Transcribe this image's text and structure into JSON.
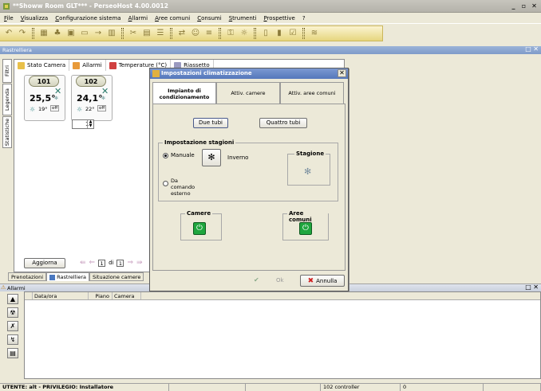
{
  "app": {
    "title": "**Showw Room GLT*** - PerseoHost 4.00.0012",
    "minimize": "_",
    "restore": "▫",
    "close": "✕"
  },
  "menu": [
    "File",
    "Visualizza",
    "Configurazione sistema",
    "Allarmi",
    "Aree comuni",
    "Consumi",
    "Strumenti",
    "Prospettive",
    "?"
  ],
  "mdi": {
    "title": "Rastrelliera",
    "close": "□ ✕"
  },
  "side_tabs": [
    "Filtri",
    "Legenda",
    "Statistiche"
  ],
  "content_tabs": [
    {
      "label": "Stato Camera"
    },
    {
      "label": "Allarmi"
    },
    {
      "label": "Temperature (°C)"
    },
    {
      "label": "Riassetto"
    }
  ],
  "rooms": [
    {
      "number": "101",
      "temp": "25,5°",
      "setpoint": "19°",
      "mode": "off"
    },
    {
      "number": "102",
      "temp": "24,1°",
      "setpoint": "22°",
      "mode": "off"
    }
  ],
  "spinner": {
    "value": "1"
  },
  "bottombar": {
    "aggiorna": "Aggiorna",
    "page": "1",
    "of": "di",
    "total": "1"
  },
  "bottom_tabs": [
    "Prenotazioni",
    "Rastrelliera",
    "Situazione camere"
  ],
  "alarms": {
    "title": "Allarmi",
    "columns": [
      "Data/ora",
      "Piano",
      "Camera"
    ]
  },
  "statusbar": {
    "user": "UTENTE: alt - PRIVILEGIO: Installatore",
    "controller": "102  controller",
    "count": "0"
  },
  "dialog": {
    "title": "Impostazioni climatizzazione",
    "tabs": [
      "Impianto di condizionamento",
      "Attiv. camere",
      "Attiv. aree comuni"
    ],
    "due_tubi": "Due tubi",
    "quattro_tubi": "Quattro tubi",
    "group_stagioni": "Impostazione stagioni",
    "manuale": "Manuale",
    "inverno": "Inverno",
    "da_comando": "Da comando esterno",
    "stagione": "Stagione",
    "camere": "Camere",
    "aree_comuni": "Aree comuni",
    "ok": "Ok",
    "annulla": "Annulla"
  },
  "colors": {
    "title_blue": "#5477bb",
    "toolbar_gold": "#e6d67e",
    "power_green": "#1fa63e"
  }
}
